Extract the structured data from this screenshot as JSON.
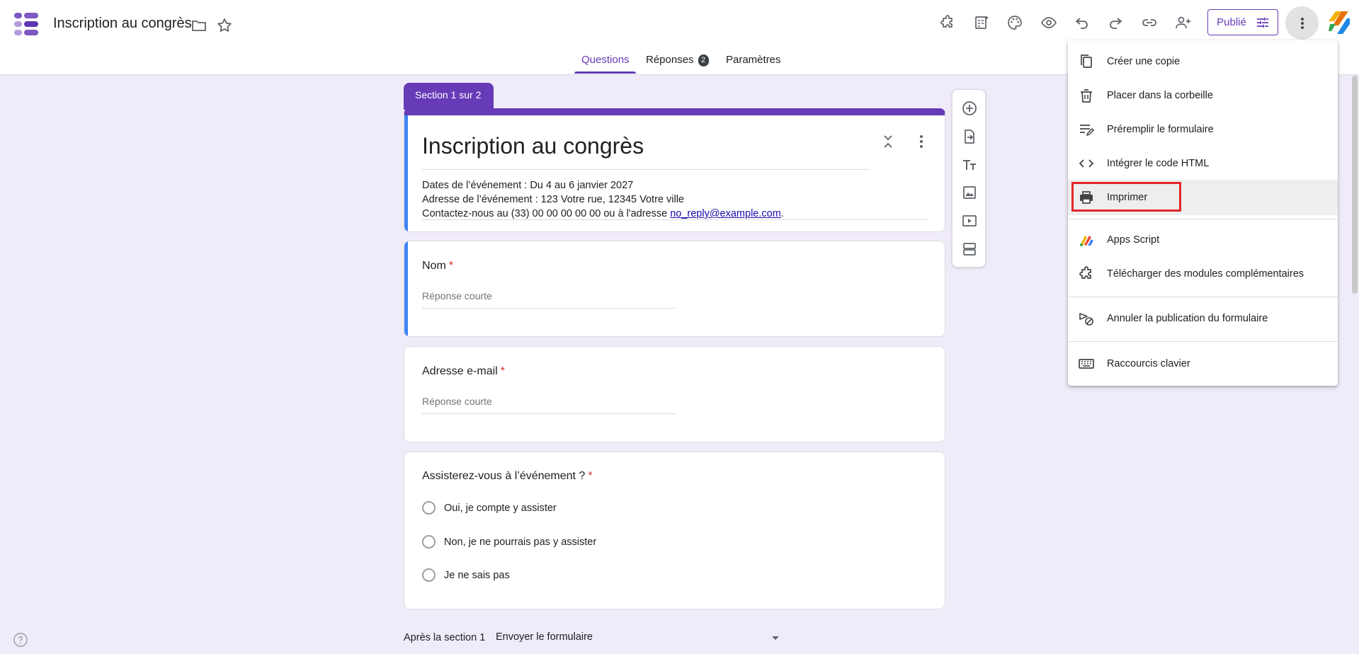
{
  "header": {
    "title": "Inscription au congrès",
    "publish_label": "Publié"
  },
  "tabs": [
    {
      "label": "Questions"
    },
    {
      "label": "Réponses",
      "badge": "2"
    },
    {
      "label": "Paramètres"
    }
  ],
  "form": {
    "section_label": "Section 1 sur 2",
    "title": "Inscription au congrès",
    "description_lines": [
      "Dates de l’événement : Du 4 au 6 janvier 2027",
      "Adresse de l’événement : 123 Votre rue, 12345 Votre ville"
    ],
    "contact_prefix": "Contactez-nous au (33) 00 00 00 00 00 ou à l'adresse ",
    "contact_email": "no_reply@example.com",
    "contact_suffix": ".",
    "questions": [
      {
        "title": "Nom",
        "required": "*",
        "placeholder": "Réponse courte"
      },
      {
        "title": "Adresse e-mail",
        "required": "*",
        "placeholder": "Réponse courte"
      },
      {
        "title": "Assisterez-vous à l’événement ?",
        "required": "*",
        "options": [
          "Oui, je compte y assister",
          "Non, je ne pourrais pas y assister",
          "Je ne sais pas"
        ]
      }
    ],
    "after_section_label": "Après la section 1",
    "after_section_value": "Envoyer le formulaire"
  },
  "menu": {
    "items": [
      {
        "label": "Créer une copie",
        "icon": "copy-icon"
      },
      {
        "label": "Placer dans la corbeille",
        "icon": "trash-icon"
      },
      {
        "label": "Préremplir le formulaire",
        "icon": "prefill-icon"
      },
      {
        "label": "Intégrer le code HTML",
        "icon": "code-icon"
      },
      {
        "label": "Imprimer",
        "icon": "print-icon"
      },
      {
        "label": "Apps Script",
        "icon": "apps-script-icon"
      },
      {
        "label": "Télécharger des modules complémentaires",
        "icon": "addon-icon"
      },
      {
        "label": "Annuler la publication du formulaire",
        "icon": "unpublish-icon"
      },
      {
        "label": "Raccourcis clavier",
        "icon": "keyboard-icon"
      }
    ]
  },
  "colors": {
    "accent": "#673ab7",
    "background": "#f0ebf8",
    "highlight": "#e52629",
    "focus_bar": "#4285f4"
  }
}
